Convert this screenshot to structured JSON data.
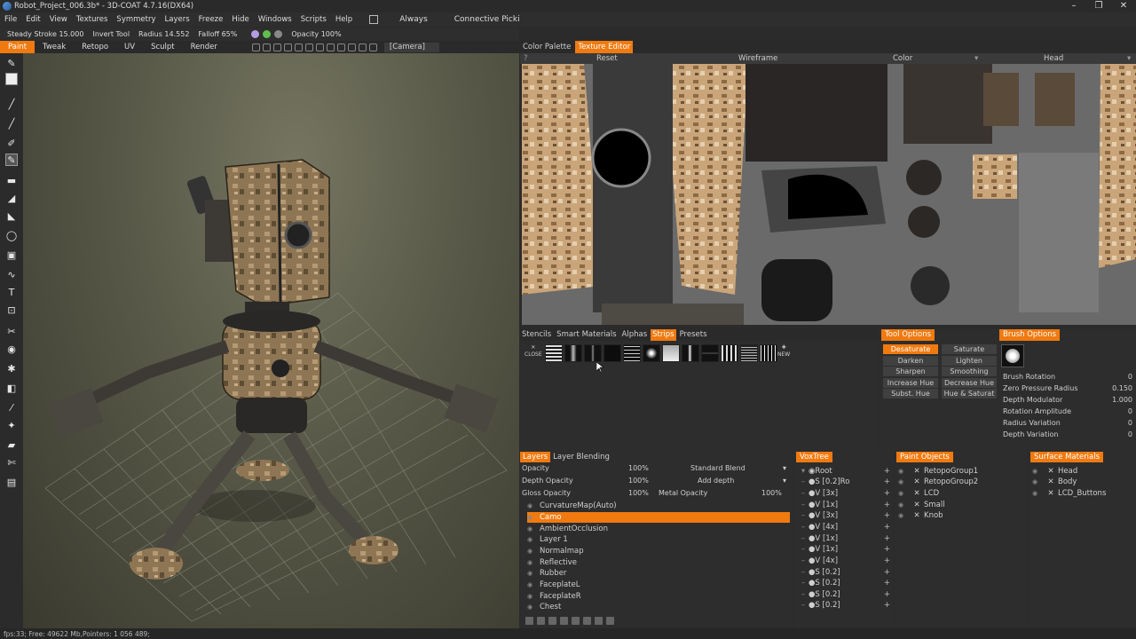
{
  "window": {
    "title": "Robot_Project_006.3b* - 3D-COAT 4.7.16(DX64)",
    "controls": [
      "–",
      "❐",
      "✕"
    ]
  },
  "menu": {
    "items": [
      "File",
      "Edit",
      "View",
      "Textures",
      "Symmetry",
      "Layers",
      "Freeze",
      "Hide",
      "Windows",
      "Scripts",
      "Help"
    ],
    "always": "Always",
    "connective": "Connective Picki"
  },
  "toolparams": {
    "steady": "Steady",
    "stroke_label": "Stroke",
    "stroke_value": "15.000",
    "invert": "Invert Tool",
    "radius_label": "Radius",
    "radius_value": "14.552",
    "falloff_label": "Falloff",
    "falloff_value": "65%",
    "opacity_label": "Opacity",
    "opacity_value": "100%"
  },
  "rooms": {
    "items": [
      "Paint",
      "Tweak",
      "Retopo",
      "UV",
      "Sculpt",
      "Render"
    ],
    "active": "Paint",
    "camera": "[Camera]"
  },
  "right_tabs": {
    "items": [
      "Color Palette",
      "Texture Editor"
    ],
    "active": "Texture Editor"
  },
  "texture_bar": {
    "reset": "Reset",
    "wireframe": "Wireframe",
    "color": "Color",
    "head": "Head"
  },
  "strips_tabs": {
    "items": [
      "Stencils",
      "Smart Materials",
      "Alphas",
      "Strips",
      "Presets"
    ],
    "active": "Strips",
    "close": "CLOSE",
    "new": "NEW"
  },
  "tool_options": {
    "title": "Tool Options",
    "buttons": [
      "Desaturate",
      "Saturate",
      "Darken",
      "Lighten",
      "Sharpen",
      "Smoothing",
      "Increase Hue",
      "Decrease Hue",
      "Subst. Hue",
      "Hue & Saturat"
    ],
    "active": "Desaturate"
  },
  "brush_options": {
    "title": "Brush Options",
    "props": [
      {
        "label": "Brush Rotation",
        "value": "0"
      },
      {
        "label": "Zero Pressure Radius",
        "value": "0.150"
      },
      {
        "label": "Depth Modulator",
        "value": "1.000"
      },
      {
        "label": "Rotation Amplitude",
        "value": "0"
      },
      {
        "label": "Radius Variation",
        "value": "0"
      },
      {
        "label": "Depth Variation",
        "value": "0"
      }
    ]
  },
  "layers": {
    "tab": "Layers",
    "tab2": "Layer Blending",
    "opacity_label": "Opacity",
    "opacity_value": "100%",
    "blend": "Standard Blend",
    "depth_label": "Depth Opacity",
    "depth_value": "100%",
    "depth_mode": "Add depth",
    "gloss_label": "Gloss Opacity",
    "gloss_value": "100%",
    "metal_label": "Metal Opacity",
    "metal_value": "100%",
    "items": [
      "CurvatureMap(Auto)",
      "Camo",
      "AmbientOcclusion",
      "Layer 1",
      "Normalmap",
      "Reflective",
      "Rubber",
      "FaceplateL",
      "FaceplateR",
      "Chest"
    ],
    "selected": "Camo"
  },
  "voxtree": {
    "title": "VoxTree",
    "rows": [
      "Root",
      "S [0.2]Ro",
      "V [3x]",
      "V [1x]",
      "V [3x]",
      "V [4x]",
      "V [1x]",
      "V [1x]",
      "V [4x]",
      "S [0.2]",
      "S [0.2]",
      "S [0.2]",
      "S [0.2]"
    ]
  },
  "paint_objects": {
    "title": "Paint Objects",
    "items": [
      "RetopoGroup1",
      "RetopoGroup2",
      "LCD",
      "Small",
      "Knob"
    ]
  },
  "surface_materials": {
    "title": "Surface Materials",
    "items": [
      "Head",
      "Body",
      "LCD_Buttons"
    ]
  },
  "status": {
    "text": "fps:33;     Free: 49622 Mb,Pointers: 1 056 489;"
  },
  "colors": {
    "accent": "#f07a10",
    "panel": "#2d2d2d",
    "bar": "#2a2a2a"
  }
}
